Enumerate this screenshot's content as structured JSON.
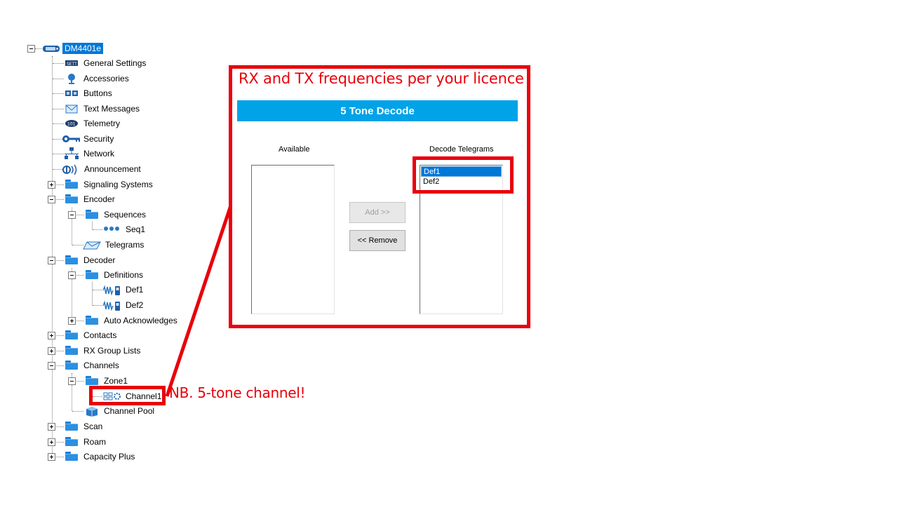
{
  "tree": {
    "root": {
      "label": "DM4401e",
      "icon": "radio-icon"
    },
    "items": [
      {
        "label": "General Settings",
        "icon": "settings-icon"
      },
      {
        "label": "Accessories",
        "icon": "microphone-icon"
      },
      {
        "label": "Buttons",
        "icon": "buttons-icon"
      },
      {
        "label": "Text Messages",
        "icon": "envelope-icon"
      },
      {
        "label": "Telemetry",
        "icon": "telemetry-icon"
      },
      {
        "label": "Security",
        "icon": "key-icon"
      },
      {
        "label": "Network",
        "icon": "network-icon"
      },
      {
        "label": "Announcement",
        "icon": "speaker-icon"
      },
      {
        "label": "Signaling Systems",
        "icon": "folder-icon"
      },
      {
        "label": "Encoder",
        "icon": "folder-icon"
      },
      {
        "label": "Sequences",
        "icon": "folder-icon"
      },
      {
        "label": "Seq1",
        "icon": "sequence-icon"
      },
      {
        "label": "Telegrams",
        "icon": "telegram-icon"
      },
      {
        "label": "Decoder",
        "icon": "folder-icon"
      },
      {
        "label": "Definitions",
        "icon": "folder-icon"
      },
      {
        "label": "Def1",
        "icon": "definition-icon"
      },
      {
        "label": "Def2",
        "icon": "definition-icon"
      },
      {
        "label": "Auto Acknowledges",
        "icon": "folder-icon"
      },
      {
        "label": "Contacts",
        "icon": "folder-icon"
      },
      {
        "label": "RX Group Lists",
        "icon": "folder-icon"
      },
      {
        "label": "Channels",
        "icon": "folder-icon"
      },
      {
        "label": "Zone1",
        "icon": "folder-icon"
      },
      {
        "label": "Channel1",
        "icon": "channel-icon"
      },
      {
        "label": "Channel Pool",
        "icon": "channel-pool-icon"
      },
      {
        "label": "Scan",
        "icon": "folder-icon"
      },
      {
        "label": "Roam",
        "icon": "folder-icon"
      },
      {
        "label": "Capacity Plus",
        "icon": "folder-icon"
      }
    ]
  },
  "callout": {
    "title": "RX and TX frequencies per your licence",
    "note": "NB. 5-tone channel!",
    "accent_color": "#e8000b"
  },
  "panel": {
    "header": "5 Tone Decode",
    "header_color": "#00a2e8",
    "available_label": "Available",
    "available_items": [],
    "decode_label": "Decode Telegrams",
    "decode_items": [
      "Def1",
      "Def2"
    ],
    "selected_item": "Def1",
    "add_label": "Add >>",
    "remove_label": "<< Remove"
  }
}
